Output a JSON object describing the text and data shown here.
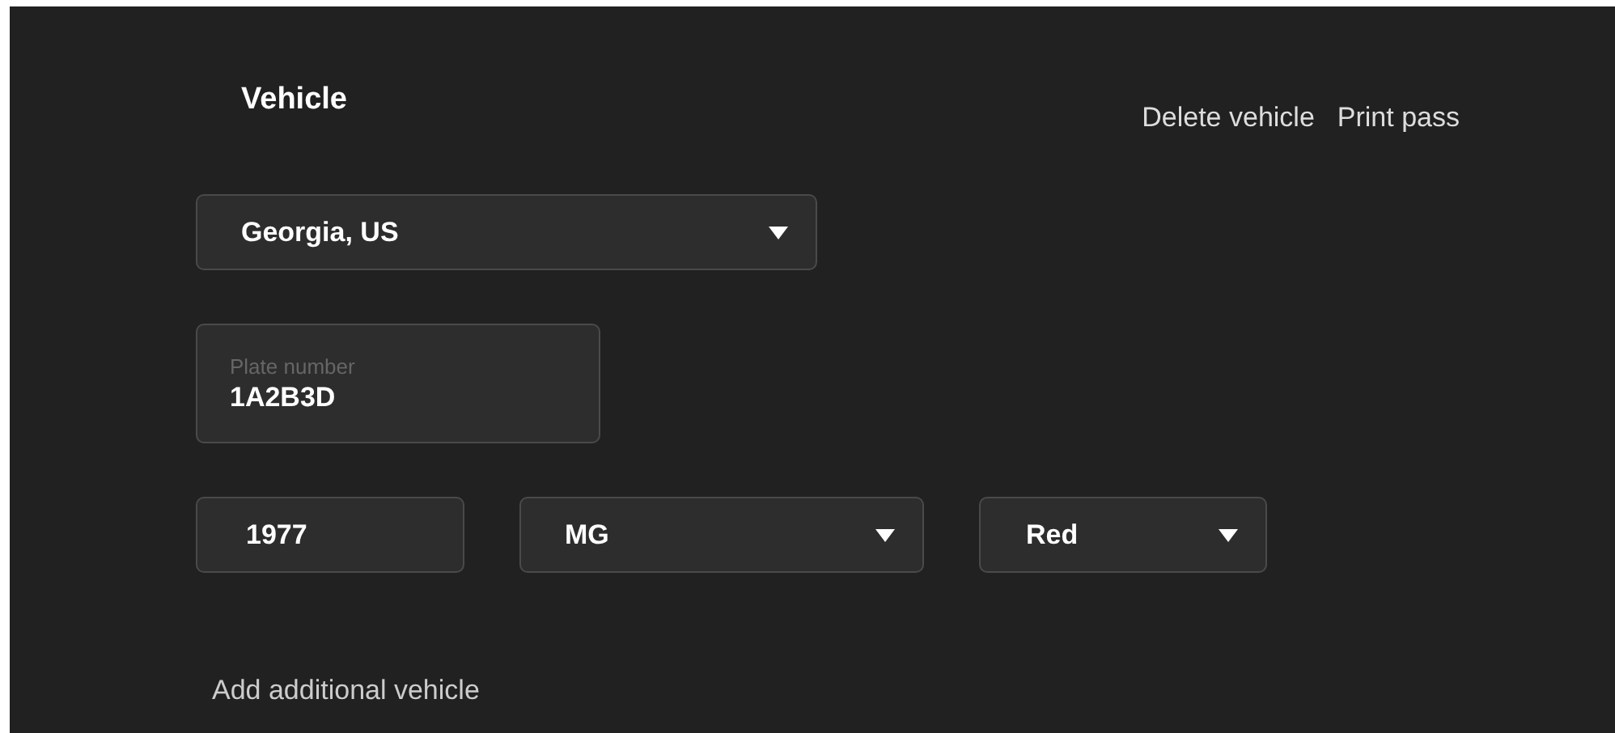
{
  "title": "Vehicle",
  "actions": [
    "Delete vehicle",
    "Print pass"
  ],
  "state_select": {
    "value": "Georgia, US"
  },
  "plate": {
    "label": "Plate number",
    "value": "1A2B3D"
  },
  "details": [
    {
      "kind": "input",
      "value": "1977"
    },
    {
      "kind": "select",
      "value": "MG"
    },
    {
      "kind": "select",
      "value": "Red"
    }
  ],
  "add_link": "Add additional vehicle"
}
